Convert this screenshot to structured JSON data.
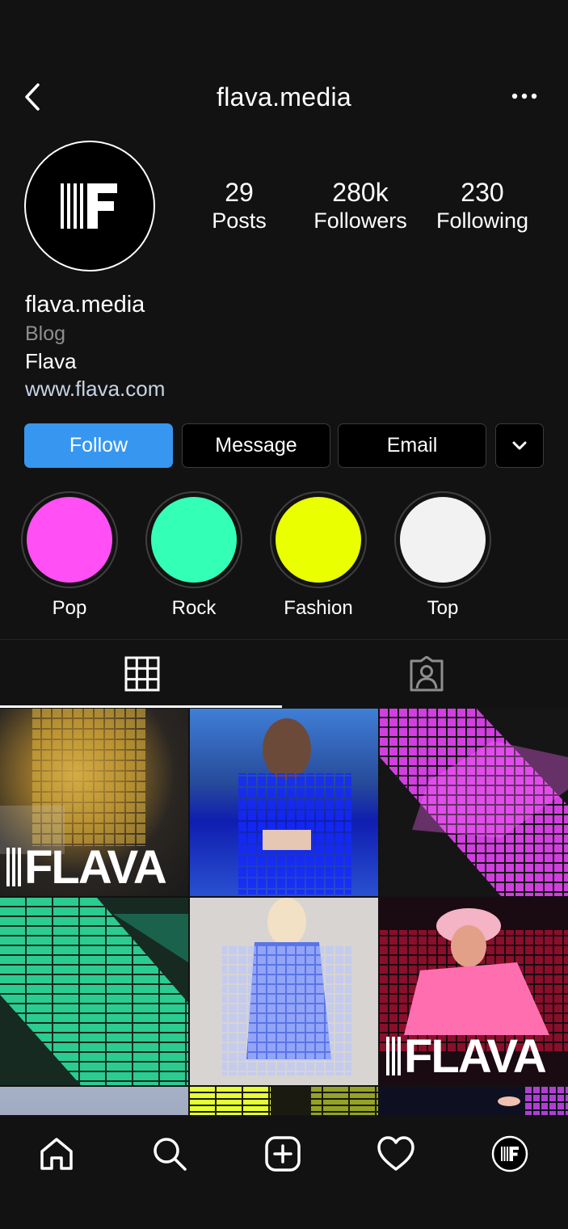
{
  "header": {
    "title": "flava.media"
  },
  "profile": {
    "avatar_letter": "F",
    "stats": [
      {
        "value": "29",
        "label": "Posts"
      },
      {
        "value": "280k",
        "label": "Followers"
      },
      {
        "value": "230",
        "label": "Following"
      }
    ],
    "bio": {
      "name": "flava.media",
      "category": "Blog",
      "text": "Flava",
      "link": "www.flava.com"
    }
  },
  "actions": {
    "follow": "Follow",
    "message": "Message",
    "email": "Email"
  },
  "highlights": [
    {
      "label": "Pop",
      "color": "#ff4ff5"
    },
    {
      "label": "Rock",
      "color": "#34ffb6"
    },
    {
      "label": "Fashion",
      "color": "#eaff00"
    },
    {
      "label": "Top",
      "color": "#f2f2f2"
    }
  ],
  "grid_posts": {
    "brand_overlay": "FLAVA"
  },
  "colors": {
    "background": "#121212",
    "accent": "#3797f0"
  },
  "nav": [
    "home-icon",
    "search-icon",
    "add-post-icon",
    "heart-icon",
    "profile-icon"
  ]
}
